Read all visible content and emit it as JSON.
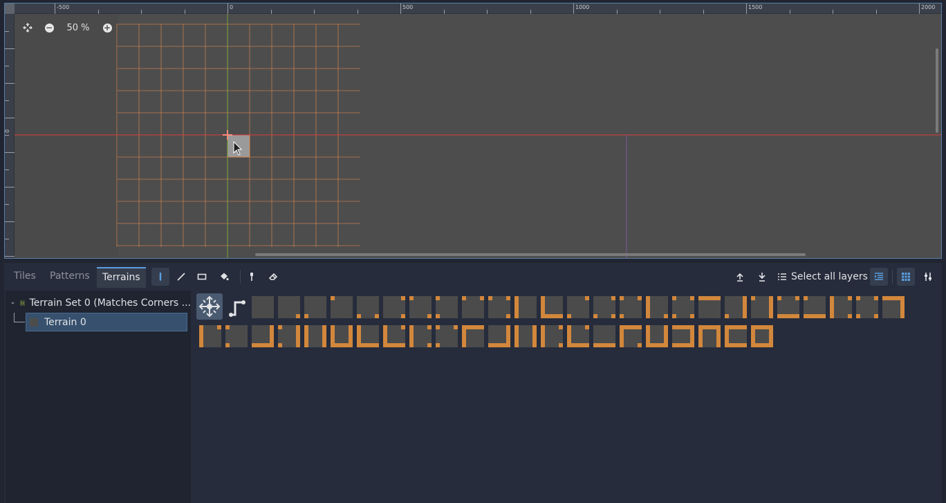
{
  "viewport": {
    "zoom_label": "50 %",
    "ruler_labels": [
      "-500",
      "0",
      "500",
      "1000",
      "1500",
      "2000"
    ],
    "ruler_zero_vertical": "0"
  },
  "panel": {
    "tabs": [
      {
        "label": "Tiles",
        "active": false
      },
      {
        "label": "Patterns",
        "active": false
      },
      {
        "label": "Terrains",
        "active": true
      }
    ],
    "select_all_layers_label": "Select all layers"
  },
  "terrain_tree": {
    "set_label": "Terrain Set 0 (Matches Corners ...",
    "terrain_label": "Terrain 0"
  },
  "colors": {
    "accent": "#5a9ee0",
    "tile_orange": "#d2873c",
    "grid_orange": "#e0884a",
    "axis_red": "#e03a3a",
    "axis_green": "#7ab23a",
    "canvas": "#4d4d4d",
    "panel": "#262c3b"
  },
  "icons": [
    "recenter-icon",
    "zoom-out-icon",
    "zoom-in-icon",
    "paint-pen-icon",
    "line-icon",
    "rect-icon",
    "bucket-icon",
    "picker-icon",
    "eraser-icon",
    "move-up-icon",
    "move-down-icon",
    "list-icon",
    "highlight-layer-icon",
    "grid-icon",
    "settings-icon",
    "connect-mode-icon",
    "path-mode-icon",
    "expand-arrow-icon",
    "terrain-set-icon"
  ]
}
